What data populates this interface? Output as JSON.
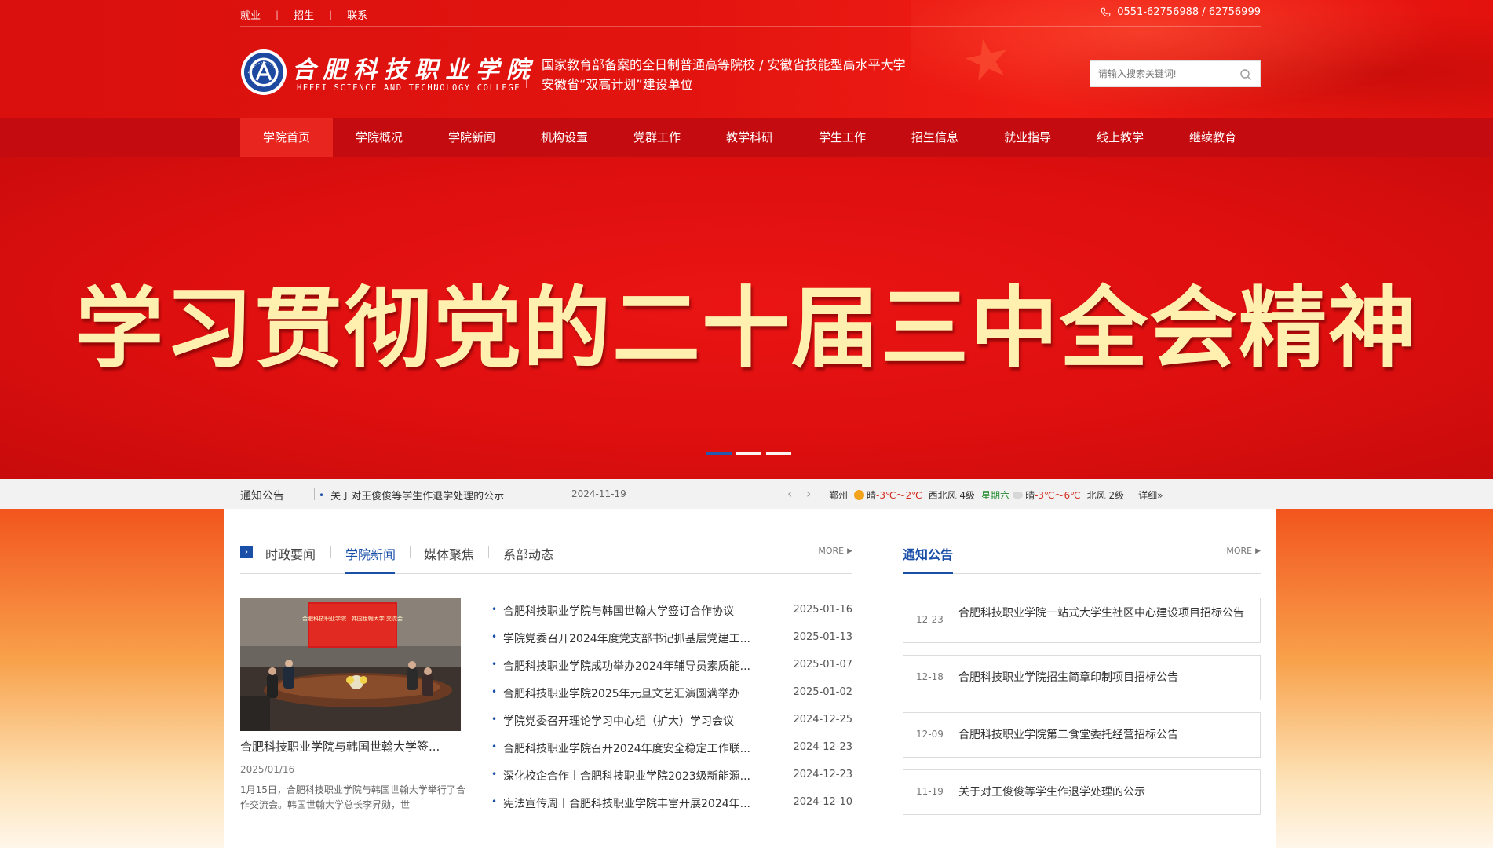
{
  "header": {
    "top_links": [
      "就业",
      "招生",
      "联系"
    ],
    "phone": "0551-62756988 / 62756999",
    "school_name_cn": "合肥科技职业学院",
    "school_name_en": "HEFEI SCIENCE AND TECHNOLOGY COLLEGE",
    "slogan_line1": "国家教育部备案的全日制普通高等院校 / 安徽省技能型高水平大学",
    "slogan_line2": "安徽省“双高计划”建设单位",
    "search_placeholder": "请输入搜索关键词!"
  },
  "nav": {
    "items": [
      "学院首页",
      "学院概况",
      "学院新闻",
      "机构设置",
      "党群工作",
      "教学科研",
      "学生工作",
      "招生信息",
      "就业指导",
      "线上教学",
      "继续教育"
    ],
    "active_index": 0
  },
  "banner": {
    "title": "学习贯彻党的二十届三中全会精神",
    "slide_count": 3,
    "active_slide": 0
  },
  "notice_bar": {
    "label": "通知公告",
    "text": "关于对王俊俊等学生作退学处理的公示",
    "date": "2024-11-19",
    "weather": {
      "city": "鄞州",
      "today_cond": "晴",
      "today_temp": "-3℃～2℃",
      "today_wind": "西北风 4级",
      "day": "星期六",
      "tomorrow_cond": "晴",
      "tomorrow_temp": "-3℃～6℃",
      "tomorrow_wind": "北风 2级",
      "detail": "详细»"
    }
  },
  "news": {
    "tabs": [
      "时政要闻",
      "学院新闻",
      "媒体聚焦",
      "系部动态"
    ],
    "active_tab": 1,
    "more": "MORE",
    "featured": {
      "caption": "合肥科技职业学院与韩国世翰大学签...",
      "date": "2025/01/16",
      "summary": "1月15日，合肥科技职业学院与韩国世翰大学举行了合作交流会。韩国世翰大学总长李昇勋，世",
      "screen_text": "合肥科技职业学院 · 韩国世翰大学 交流会"
    },
    "items": [
      {
        "title": "合肥科技职业学院与韩国世翰大学签订合作协议",
        "date": "2025-01-16"
      },
      {
        "title": "学院党委召开2024年度党支部书记抓基层党建工...",
        "date": "2025-01-13"
      },
      {
        "title": "合肥科技职业学院成功举办2024年辅导员素质能...",
        "date": "2025-01-07"
      },
      {
        "title": "合肥科技职业学院2025年元旦文艺汇演圆满举办",
        "date": "2025-01-02"
      },
      {
        "title": "学院党委召开理论学习中心组（扩大）学习会议",
        "date": "2024-12-25"
      },
      {
        "title": "合肥科技职业学院召开2024年度安全稳定工作联...",
        "date": "2024-12-23"
      },
      {
        "title": "深化校企合作丨合肥科技职业学院2023级新能源...",
        "date": "2024-12-23"
      },
      {
        "title": "宪法宣传周丨合肥科技职业学院丰富开展2024年...",
        "date": "2024-12-10"
      }
    ]
  },
  "notices": {
    "title": "通知公告",
    "more": "MORE",
    "items": [
      {
        "date": "12-23",
        "title": "合肥科技职业学院一站式大学生社区中心建设项目招标公告"
      },
      {
        "date": "12-18",
        "title": "合肥科技职业学院招生简章印制项目招标公告"
      },
      {
        "date": "12-09",
        "title": "合肥科技职业学院第二食堂委托经营招标公告"
      },
      {
        "date": "11-19",
        "title": "关于对王俊俊等学生作退学处理的公示"
      }
    ]
  },
  "icons": {
    "phone": "phone-icon",
    "search": "search-icon",
    "logo": "school-logo",
    "tab_marker": "chevron-right-icon",
    "more_arrow": "triangle-right-icon"
  },
  "colors": {
    "header_red": "#e2140f",
    "nav_red": "#c40c10",
    "nav_active": "#e8261f",
    "accent_blue": "#1a4fa8",
    "banner_text": "#fff0b0"
  }
}
